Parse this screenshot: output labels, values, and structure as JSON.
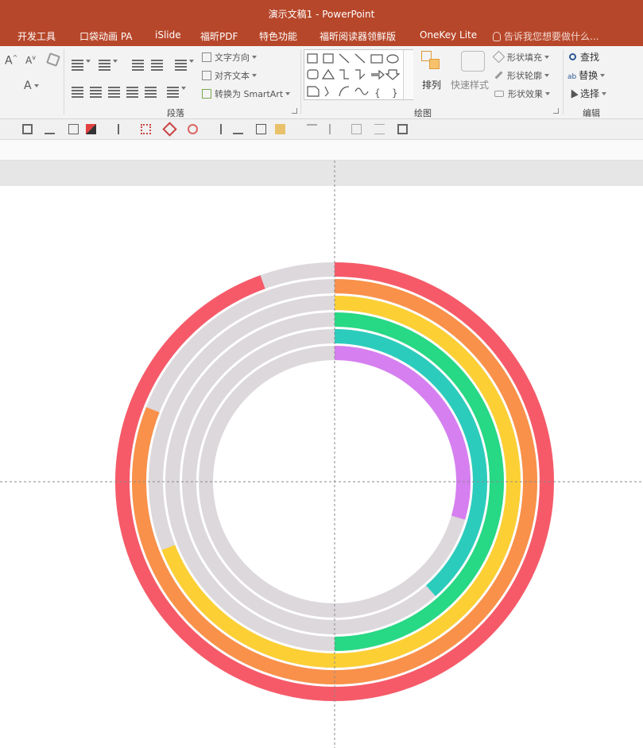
{
  "window": {
    "title": "演示文稿1 - PowerPoint"
  },
  "menu": {
    "items": [
      "开发工具",
      "口袋动画 PA",
      "iSlide",
      "福昕PDF",
      "特色功能",
      "福昕阅读器领鲜版",
      "OneKey Lite"
    ],
    "tell_me": "告诉我您想要做什么..."
  },
  "ribbon": {
    "paragraph": {
      "label": "段落",
      "text_direction": "文字方向",
      "align_text": "对齐文本",
      "convert_smartart": "转换为 SmartArt"
    },
    "drawing": {
      "label": "绘图",
      "arrange": "排列",
      "quick_styles": "快速样式",
      "shape_fill": "形状填充",
      "shape_outline": "形状轮廓",
      "shape_effects": "形状效果"
    },
    "editing": {
      "label": "编辑",
      "find": "查找",
      "replace": "替换",
      "select": "选择"
    }
  },
  "colors": {
    "brand": "#b7472a",
    "ring_track": "#dcd8dc",
    "red": "#f65a69",
    "orange": "#f9914a",
    "yellow": "#fcd034",
    "green": "#27d885",
    "teal": "#2cccbd",
    "purple": "#d67ff0"
  },
  "chart_data": {
    "type": "radial-bar",
    "title": "",
    "series": [
      {
        "color": "red",
        "value": 0.945
      },
      {
        "color": "orange",
        "value": 0.81
      },
      {
        "color": "yellow",
        "value": 0.69
      },
      {
        "color": "green",
        "value": 0.5
      },
      {
        "color": "teal",
        "value": 0.385
      },
      {
        "color": "purple",
        "value": 0.295
      }
    ]
  }
}
